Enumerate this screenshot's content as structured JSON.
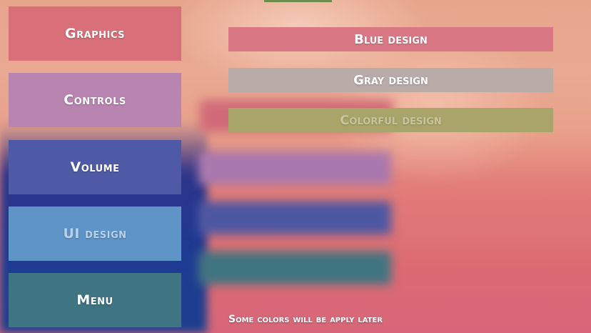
{
  "sidebar": {
    "items": [
      {
        "label": "Graphics",
        "color": "#d96f79"
      },
      {
        "label": "Controls",
        "color": "#b885b0"
      },
      {
        "label": "Volume",
        "color": "#4f5aa6"
      },
      {
        "label": "UI design",
        "color": "#5f94c6",
        "text_color": "#b8d1ea"
      },
      {
        "label": "Menu",
        "color": "#3f7482"
      }
    ]
  },
  "design_options": [
    {
      "label": "Blue design",
      "color": "#d97884",
      "text_color": "#ffffff"
    },
    {
      "label": "Gray design",
      "color": "#b8aba8",
      "text_color": "#ffffff"
    },
    {
      "label": "Colorful design",
      "color": "#a9a46a",
      "text_color": "#c9c59a"
    }
  ],
  "footer_note": "Some colors will be apply later"
}
